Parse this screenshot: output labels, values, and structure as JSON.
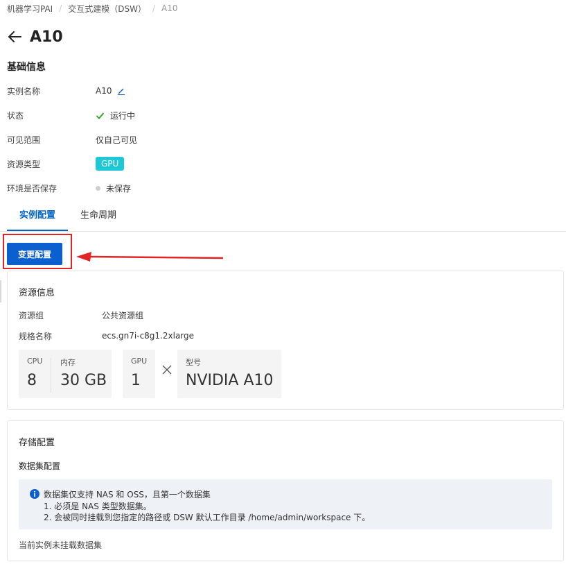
{
  "breadcrumb": [
    {
      "label": "机器学习PAI"
    },
    {
      "label": "交互式建模（DSW）"
    },
    {
      "label": "A10"
    }
  ],
  "header": {
    "title": "A10",
    "back_icon": "arrow-left-icon"
  },
  "basic_info": {
    "title": "基础信息",
    "instance_name": {
      "label": "实例名称",
      "value": "A10"
    },
    "status": {
      "label": "状态",
      "value": "运行中",
      "color": "#2ea121"
    },
    "visibility": {
      "label": "可见范围",
      "value": "仅自己可见"
    },
    "resource_type": {
      "label": "资源类型",
      "value": "GPU",
      "color": "#1ec8d4"
    },
    "env_saved": {
      "label": "环境是否保存",
      "value": "未保存"
    }
  },
  "tabs": [
    {
      "label": "实例配置",
      "active": true
    },
    {
      "label": "生命周期",
      "active": false
    }
  ],
  "actions": {
    "change_config_label": "变更配置",
    "accent": "#0c5fcf",
    "annotation_color": "#e12525"
  },
  "resource_info": {
    "title": "资源信息",
    "resource_group": {
      "label": "资源组",
      "value": "公共资源组"
    },
    "spec_name": {
      "label": "规格名称",
      "value": "ecs.gn7i-c8g1.2xlarge"
    },
    "cpu": {
      "label": "CPU",
      "value": "8"
    },
    "memory": {
      "label": "内存",
      "value": "30 GB"
    },
    "gpu": {
      "label": "GPU",
      "value": "1"
    },
    "model": {
      "label": "型号",
      "value": "NVIDIA A10"
    }
  },
  "storage": {
    "title": "存储配置",
    "dataset_title": "数据集配置",
    "notice": [
      "数据集仅支持 NAS 和 OSS，且第一个数据集",
      "1. 必须是 NAS 类型数据集。",
      "2. 会被同时挂载到您指定的路径或 DSW 默认工作目录 /home/admin/workspace 下。"
    ],
    "empty_text": "当前实例未挂载数据集"
  }
}
